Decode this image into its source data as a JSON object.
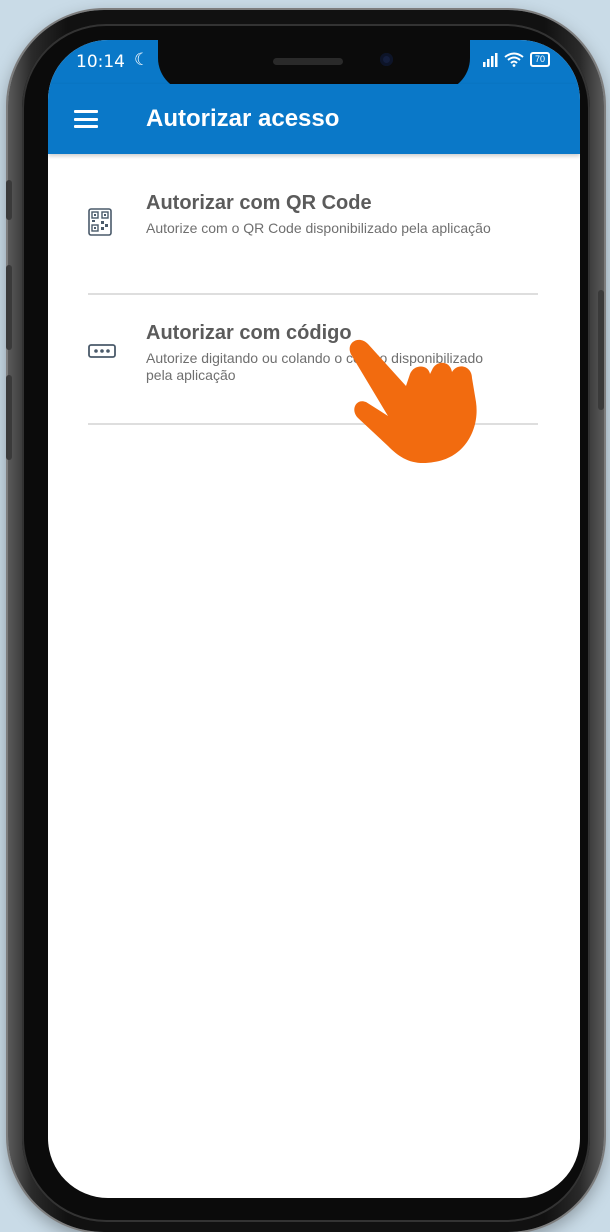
{
  "status_bar": {
    "time": "10:14",
    "battery": "70"
  },
  "app_bar": {
    "title": "Autorizar acesso"
  },
  "options": [
    {
      "title": "Autorizar com QR Code",
      "description": "Autorize com o QR Code disponibilizado pela aplicação",
      "icon": "qr-code-icon"
    },
    {
      "title": "Autorizar com código",
      "description": "Autorize digitando ou colando o código disponibilizado pela aplicação",
      "icon": "password-dots-icon"
    }
  ],
  "colors": {
    "primary": "#0a78c8",
    "hand": "#f26b0f"
  }
}
